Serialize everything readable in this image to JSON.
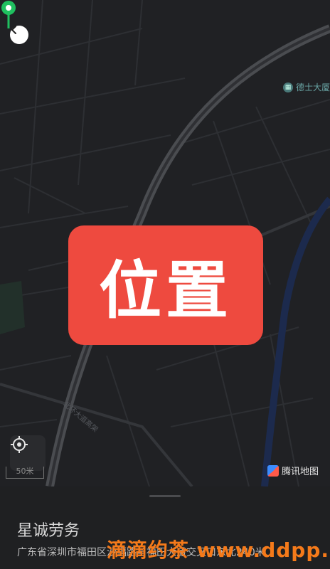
{
  "map": {
    "poi_label": "德士大厦",
    "road_label": "北环大道高架",
    "scale_label": "50米",
    "brand_label": "腾讯地图",
    "location_banner": "位置"
  },
  "sheet": {
    "place_name": "星诚劳务",
    "address": "广东省深圳市福田区沙福路与福田大道交叉口东北240米",
    "watermark": "滴滴约茶 www.ddpp.info"
  },
  "colors": {
    "pin": "#1fbf5f",
    "banner": "#ee4a3f",
    "watermark": "#f57a1a"
  },
  "icons": [
    "back-icon",
    "building-icon",
    "map-pin-icon",
    "locate-icon",
    "tencent-map-logo"
  ]
}
